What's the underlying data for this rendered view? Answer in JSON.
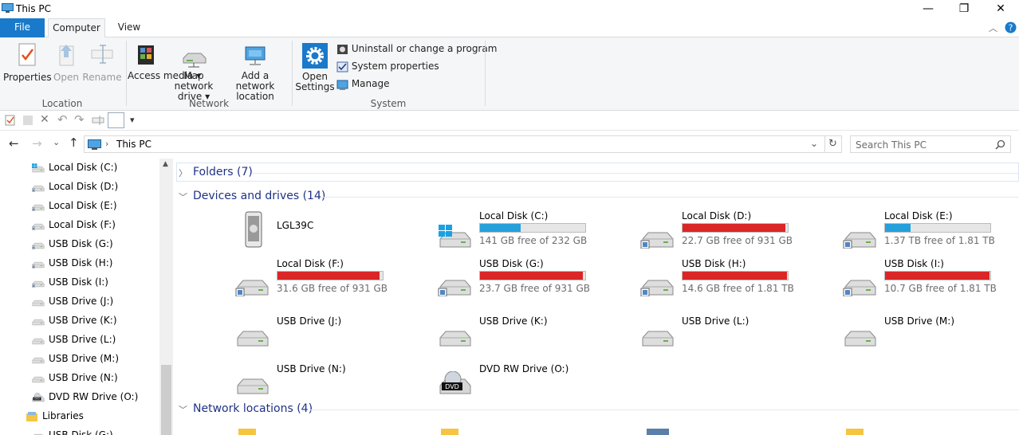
{
  "window": {
    "title": "This PC",
    "minimize": "—",
    "maximize": "❐",
    "close": "✕"
  },
  "tabs": {
    "file": "File",
    "computer": "Computer",
    "view": "View"
  },
  "ribbon": {
    "properties": "Properties",
    "open": "Open",
    "rename": "Rename",
    "access_media": "Access media",
    "map_network_drive": "Map network drive",
    "add_network_location": "Add a network location",
    "open_settings": "Open Settings",
    "uninstall": "Uninstall or change a program",
    "system_properties": "System properties",
    "manage": "Manage",
    "groups": {
      "location": "Location",
      "network": "Network",
      "system": "System"
    }
  },
  "address": {
    "path": "This PC",
    "search_placeholder": "Search This PC"
  },
  "nav": [
    {
      "label": "Local Disk (C:)",
      "icon": "windows-drive-icon"
    },
    {
      "label": "Local Disk  (D:)",
      "icon": "drive-icon"
    },
    {
      "label": "Local Disk  (E:)",
      "icon": "drive-icon"
    },
    {
      "label": "Local Disk  (F:)",
      "icon": "drive-icon"
    },
    {
      "label": "USB Disk (G:)",
      "icon": "drive-icon"
    },
    {
      "label": "USB Disk (H:)",
      "icon": "drive-icon"
    },
    {
      "label": "USB Disk (I:)",
      "icon": "drive-icon"
    },
    {
      "label": "USB Drive (J:)",
      "icon": "usb-drive-icon"
    },
    {
      "label": "USB Drive (K:)",
      "icon": "usb-drive-icon"
    },
    {
      "label": "USB Drive (L:)",
      "icon": "usb-drive-icon"
    },
    {
      "label": "USB Drive (M:)",
      "icon": "usb-drive-icon"
    },
    {
      "label": "USB Drive (N:)",
      "icon": "usb-drive-icon"
    },
    {
      "label": "DVD RW Drive (O:)",
      "icon": "dvd-drive-icon"
    },
    {
      "label": "Libraries",
      "icon": "libraries-icon"
    },
    {
      "label": "USB Disk (G:)",
      "icon": "drive-icon"
    }
  ],
  "groups": {
    "folders": "Folders (7)",
    "devices": "Devices and drives (14)",
    "network": "Network locations (4)"
  },
  "drives": [
    {
      "name": "LGL39C",
      "free": "",
      "used_fraction": null,
      "bar_color": "",
      "icon": "phone-icon"
    },
    {
      "name": "Local Disk (C:)",
      "free": "141 GB free of 232 GB",
      "used_fraction": 0.39,
      "bar_color": "#26a0da",
      "icon": "windows-drive-icon"
    },
    {
      "name": "Local Disk  (D:)",
      "free": "22.7 GB free of 931 GB",
      "used_fraction": 0.976,
      "bar_color": "#da2626",
      "icon": "drive-icon"
    },
    {
      "name": "Local Disk  (E:)",
      "free": "1.37 TB free of 1.81 TB",
      "used_fraction": 0.24,
      "bar_color": "#26a0da",
      "icon": "drive-icon"
    },
    {
      "name": "Local Disk  (F:)",
      "free": "31.6 GB free of 931 GB",
      "used_fraction": 0.966,
      "bar_color": "#da2626",
      "icon": "drive-icon"
    },
    {
      "name": "USB Disk (G:)",
      "free": "23.7 GB free of 931 GB",
      "used_fraction": 0.975,
      "bar_color": "#da2626",
      "icon": "drive-icon"
    },
    {
      "name": "USB Disk (H:)",
      "free": "14.6 GB free of 1.81 TB",
      "used_fraction": 0.992,
      "bar_color": "#da2626",
      "icon": "drive-icon"
    },
    {
      "name": "USB Disk (I:)",
      "free": "10.7 GB free of 1.81 TB",
      "used_fraction": 0.994,
      "bar_color": "#da2626",
      "icon": "drive-icon"
    },
    {
      "name": "USB Drive (J:)",
      "free": "",
      "used_fraction": null,
      "bar_color": "",
      "icon": "usb-drive-icon"
    },
    {
      "name": "USB Drive (K:)",
      "free": "",
      "used_fraction": null,
      "bar_color": "",
      "icon": "usb-drive-icon"
    },
    {
      "name": "USB Drive (L:)",
      "free": "",
      "used_fraction": null,
      "bar_color": "",
      "icon": "usb-drive-icon"
    },
    {
      "name": "USB Drive (M:)",
      "free": "",
      "used_fraction": null,
      "bar_color": "",
      "icon": "usb-drive-icon"
    },
    {
      "name": "USB Drive (N:)",
      "free": "",
      "used_fraction": null,
      "bar_color": "",
      "icon": "usb-drive-icon"
    },
    {
      "name": "DVD RW Drive (O:)",
      "free": "",
      "used_fraction": null,
      "bar_color": "",
      "icon": "dvd-drive-icon"
    }
  ]
}
